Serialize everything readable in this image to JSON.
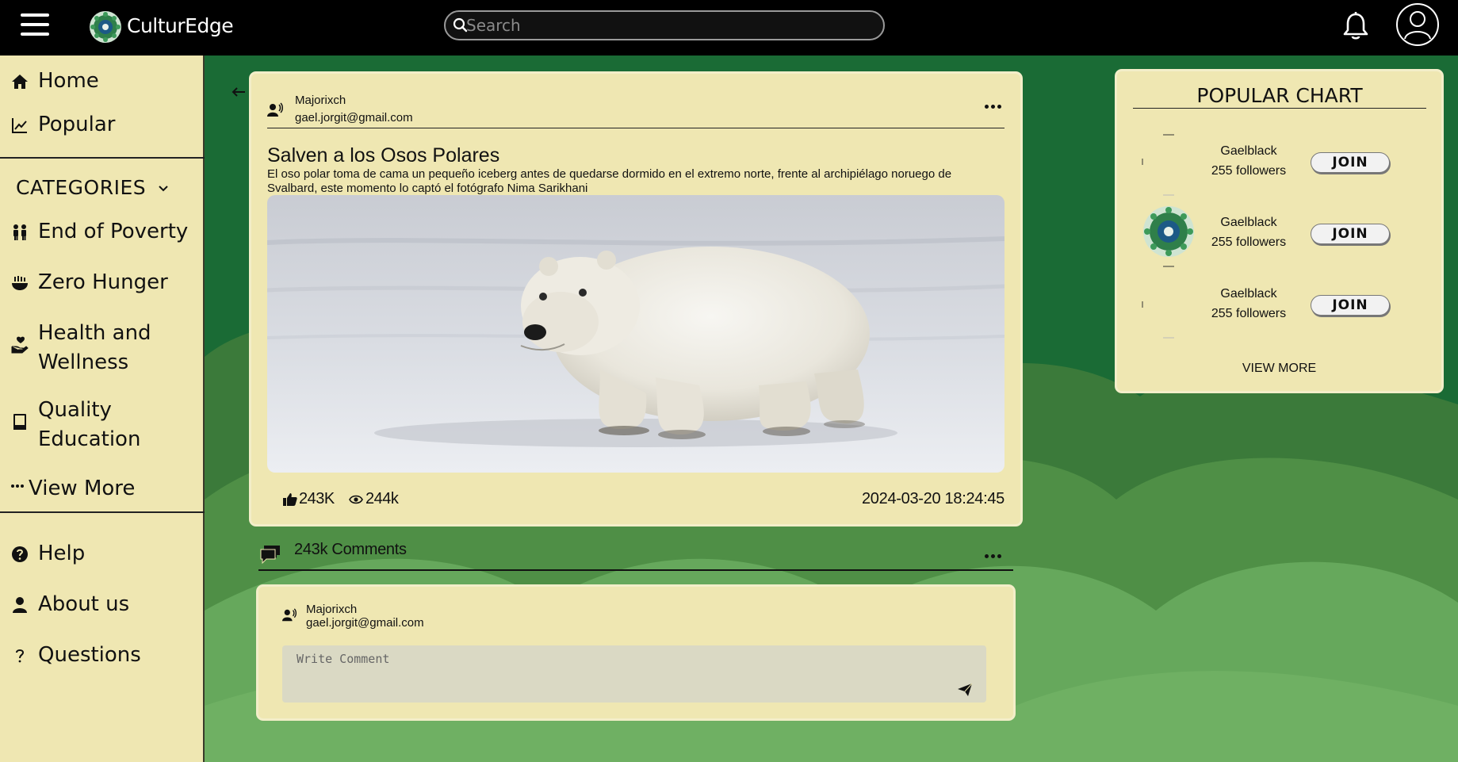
{
  "header": {
    "brand": "CulturEdge",
    "search_placeholder": "Search"
  },
  "sidebar": {
    "main_items": [
      {
        "label": "Home",
        "icon": "home-icon"
      },
      {
        "label": "Popular",
        "icon": "chart-icon"
      }
    ],
    "categories_title": "CATEGORIES",
    "categories": [
      {
        "label": "End of Poverty",
        "icon": "people-icon"
      },
      {
        "label": "Zero Hunger",
        "icon": "bowl-icon"
      },
      {
        "label": "Health and Wellness",
        "line1": "Health and",
        "line2": "Wellness",
        "icon": "hand-heart-icon"
      },
      {
        "label": "Quality Education",
        "line1": "Quality",
        "line2": "Education",
        "icon": "book-icon"
      },
      {
        "label": "View More",
        "icon": "ellipsis-icon"
      }
    ],
    "footer_items": [
      {
        "label": "Help",
        "icon": "question-circle-icon"
      },
      {
        "label": "About us",
        "icon": "person-icon"
      },
      {
        "label": "Questions",
        "icon": "question-icon"
      }
    ]
  },
  "post": {
    "author_name": "Majorixch",
    "author_email": "gael.jorgit@gmail.com",
    "title": "Salven a los Osos Polares",
    "description": "El oso polar toma de cama un pequeño iceberg antes de quedarse dormido en el extremo norte, frente al archipiélago noruego de Svalbard, este momento lo captó el fotógrafo Nima Sarikhani",
    "likes": "243K",
    "views": "244k",
    "date": "2024-03-20 18:24:45"
  },
  "comments": {
    "count_label": "243k Comments",
    "author_name": "Majorixch",
    "author_email": "gael.jorgit@gmail.com",
    "input_placeholder": "Write Comment"
  },
  "popular_chart": {
    "title": "POPULAR CHART",
    "items": [
      {
        "name": "Gaelblack",
        "followers": "255 followers",
        "join_label": "JOIN"
      },
      {
        "name": "Gaelblack",
        "followers": "255 followers",
        "join_label": "JOIN"
      },
      {
        "name": "Gaelblack",
        "followers": "255 followers",
        "join_label": "JOIN"
      }
    ],
    "view_more_label": "VIEW MORE"
  },
  "colors": {
    "background_green": "#1a6b35",
    "panel_cream": "#efe7b2",
    "topbar": "#000000"
  }
}
